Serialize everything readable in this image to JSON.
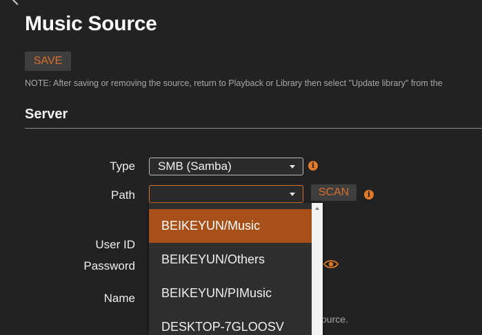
{
  "page": {
    "title": "Music Source",
    "save_label": "SAVE",
    "note": "NOTE: After saving or removing the source, return to Playback or Library then select \"Update library\" from the"
  },
  "server": {
    "section_title": "Server",
    "type_label": "Type",
    "type_value": "SMB (Samba)",
    "path_label": "Path",
    "path_value": "",
    "scan_label": "SCAN",
    "userid_label": "User ID",
    "password_label": "Password",
    "name_label": "Name",
    "hint_fragment": "source."
  },
  "path_dropdown": {
    "options": [
      {
        "label": "BEIKEYUN/Music",
        "selected": true
      },
      {
        "label": "BEIKEYUN/Others",
        "selected": false
      },
      {
        "label": "BEIKEYUN/PIMusic",
        "selected": false
      },
      {
        "label": "DESKTOP-7GLOOSV",
        "selected": false
      }
    ]
  },
  "icons": {
    "back": "chevron-left-icon",
    "info": "info-icon",
    "password_visibility": "eye-icon"
  },
  "colors": {
    "accent": "#d9702a",
    "selected_option": "#a8501a",
    "background": "#222222"
  }
}
